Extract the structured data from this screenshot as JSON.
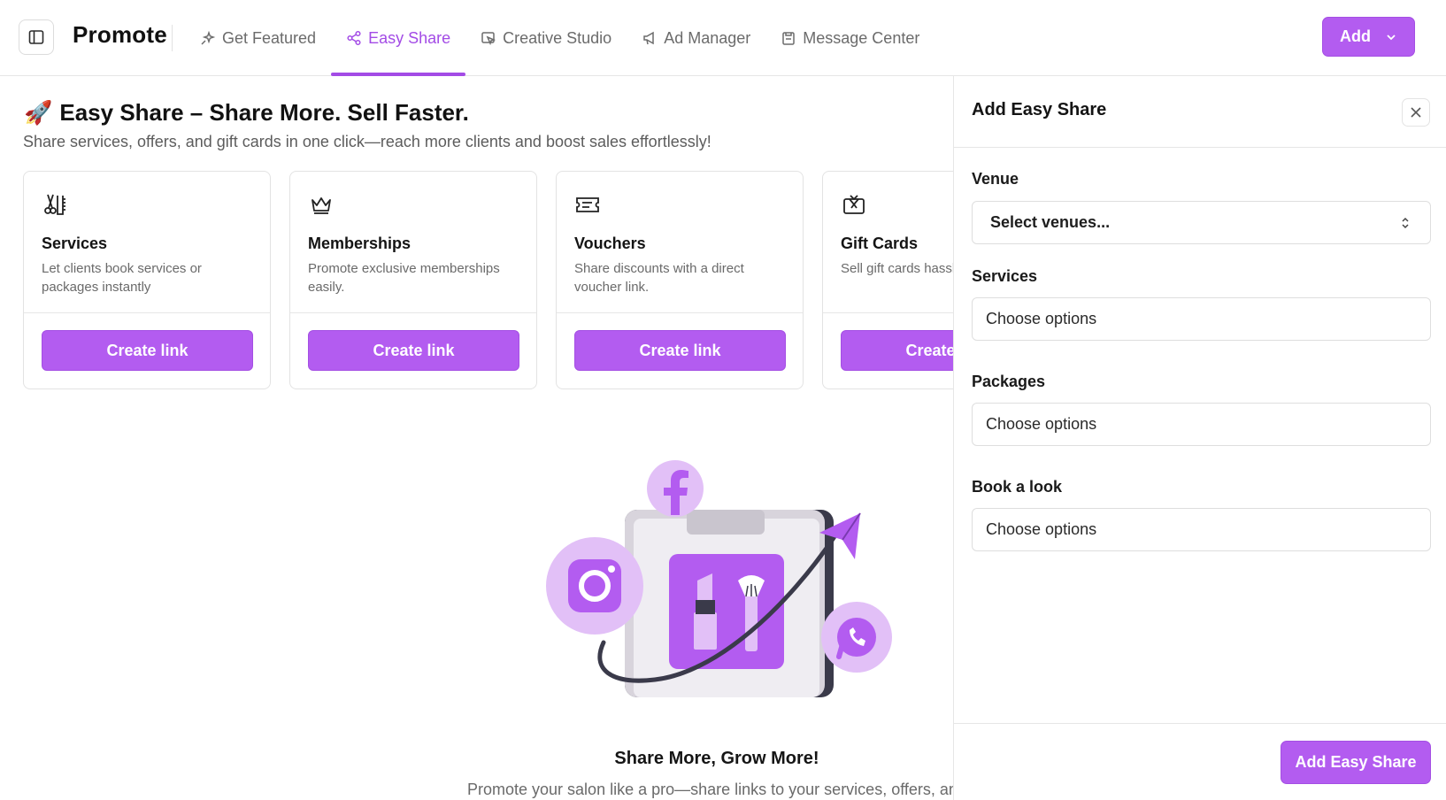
{
  "header": {
    "brand": "Promote",
    "tabs": [
      {
        "label": "Get Featured",
        "icon": "sparkle-icon"
      },
      {
        "label": "Easy Share",
        "icon": "share-icon",
        "active": true
      },
      {
        "label": "Creative Studio",
        "icon": "design-icon"
      },
      {
        "label": "Ad Manager",
        "icon": "megaphone-icon"
      },
      {
        "label": "Message Center",
        "icon": "inbox-icon"
      }
    ],
    "add_label": "Add"
  },
  "main": {
    "title_emoji": "🚀",
    "title": "Easy Share – Share More. Sell Faster.",
    "subtitle": "Share services, offers, and gift cards in one click—reach more clients and boost sales effortlessly!",
    "cards": [
      {
        "title": "Services",
        "desc": "Let clients book services or packages instantly",
        "button": "Create link",
        "icon": "scissors-comb-icon"
      },
      {
        "title": "Memberships",
        "desc": "Promote exclusive memberships easily.",
        "button": "Create link",
        "icon": "crown-icon"
      },
      {
        "title": "Vouchers",
        "desc": "Share discounts with a direct voucher link.",
        "button": "Create link",
        "icon": "ticket-icon"
      },
      {
        "title": "Gift Cards",
        "desc": "Sell gift cards hassle-free online.",
        "button": "Create link",
        "icon": "gift-card-icon"
      }
    ],
    "empty_title": "Share More, Grow More!",
    "empty_subtitle": "Promote your salon like a pro—share links to your services, offers, and more."
  },
  "drawer": {
    "title": "Add Easy Share",
    "fields": [
      {
        "label": "Venue",
        "value": "Select venues..."
      },
      {
        "label": "Services",
        "placeholder": "Choose options"
      },
      {
        "label": "Packages",
        "placeholder": "Choose options"
      },
      {
        "label": "Book a look",
        "placeholder": "Choose options"
      }
    ],
    "submit_label": "Add Easy Share"
  },
  "colors": {
    "accent": "#b35cf0",
    "accent_text": "#a34be6",
    "illustration_light": "#e2c0f7",
    "illustration_dark": "#3a3a4a"
  }
}
